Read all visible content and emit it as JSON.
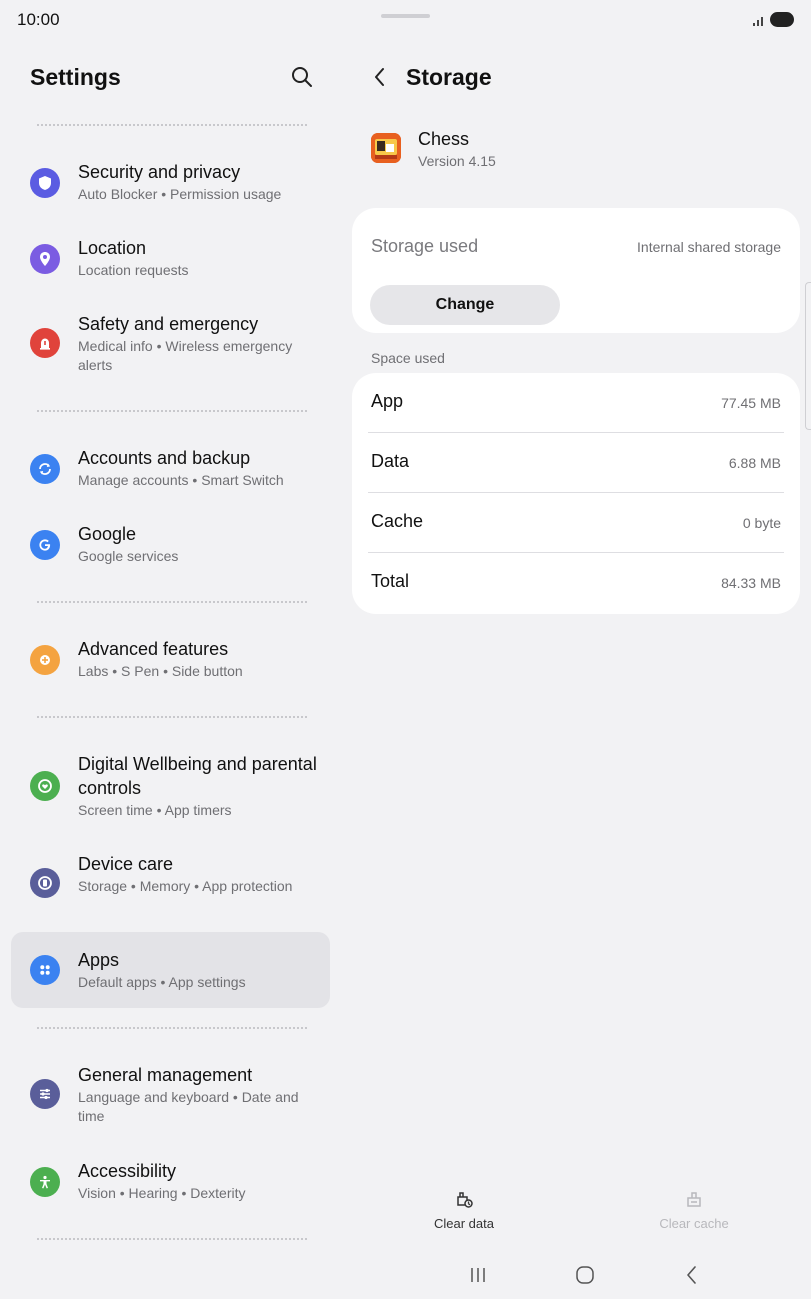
{
  "status_bar": {
    "time": "10:00"
  },
  "settings": {
    "title": "Settings",
    "items": [
      {
        "title": "Security and privacy",
        "subtitle": "Auto Blocker  •  Permission usage",
        "icon": "shield-icon",
        "color": "#5b5ce2"
      },
      {
        "title": "Location",
        "subtitle": "Location requests",
        "icon": "location-pin-icon",
        "color": "#7b5ce2"
      },
      {
        "title": "Safety and emergency",
        "subtitle": "Medical info  •  Wireless emergency alerts",
        "icon": "alert-icon",
        "color": "#e0433b"
      },
      {
        "title": "Accounts and backup",
        "subtitle": "Manage accounts  •  Smart Switch",
        "icon": "sync-icon",
        "color": "#3b82f1"
      },
      {
        "title": "Google",
        "subtitle": "Google services",
        "icon": "google-icon",
        "color": "#3b82f1"
      },
      {
        "title": "Advanced features",
        "subtitle": "Labs  •  S Pen  •  Side button",
        "icon": "gear-plus-icon",
        "color": "#f4a340"
      },
      {
        "title": "Digital Wellbeing and parental controls",
        "subtitle": "Screen time  •  App timers",
        "icon": "wellbeing-icon",
        "color": "#4caf50"
      },
      {
        "title": "Device care",
        "subtitle": "Storage  •  Memory  •  App protection",
        "icon": "device-care-icon",
        "color": "#5a5e9a"
      },
      {
        "title": "Apps",
        "subtitle": "Default apps  •  App settings",
        "icon": "apps-icon",
        "color": "#3b82f1"
      },
      {
        "title": "General management",
        "subtitle": "Language and keyboard  •  Date and time",
        "icon": "sliders-icon",
        "color": "#5a5e9a"
      },
      {
        "title": "Accessibility",
        "subtitle": "Vision  •  Hearing  •  Dexterity",
        "icon": "accessibility-icon",
        "color": "#4caf50"
      }
    ]
  },
  "storage": {
    "title": "Storage",
    "app_name": "Chess",
    "app_version": "Version 4.15",
    "storage_used_label": "Storage used",
    "storage_used_value": "Internal shared storage",
    "change_label": "Change",
    "space_used_label": "Space used",
    "rows": [
      {
        "label": "App",
        "value": "77.45 MB"
      },
      {
        "label": "Data",
        "value": "6.88 MB"
      },
      {
        "label": "Cache",
        "value": "0 byte"
      },
      {
        "label": "Total",
        "value": "84.33 MB"
      }
    ]
  },
  "actions": {
    "clear_data": "Clear data",
    "clear_cache": "Clear cache"
  }
}
